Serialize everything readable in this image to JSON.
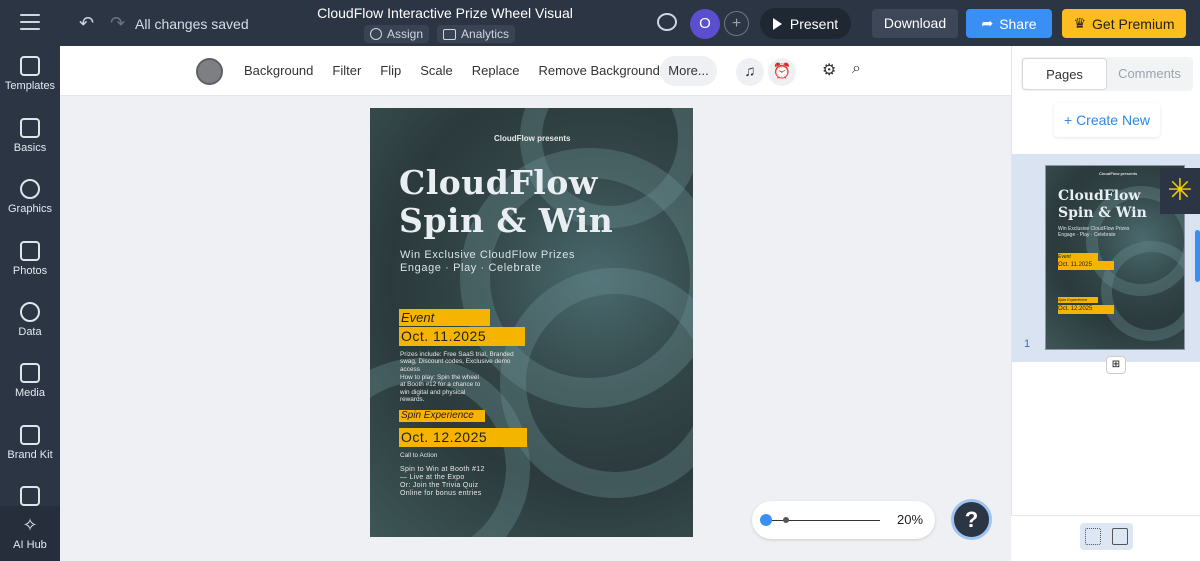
{
  "header": {
    "saved_status": "All changes saved",
    "title": "CloudFlow Interactive Prize Wheel Visual",
    "assign_label": "Assign",
    "analytics_label": "Analytics",
    "avatar_initial": "O",
    "present_label": "Present",
    "download_label": "Download",
    "share_label": "Share",
    "premium_label": "Get Premium"
  },
  "sidebar": {
    "items": [
      {
        "label": "Templates"
      },
      {
        "label": "Basics"
      },
      {
        "label": "Graphics"
      },
      {
        "label": "Photos"
      },
      {
        "label": "Data"
      },
      {
        "label": "Media"
      },
      {
        "label": "Brand Kit"
      },
      {
        "label": ""
      },
      {
        "label": "AI Hub"
      }
    ]
  },
  "toolbar": {
    "items": [
      "Background",
      "Filter",
      "Flip",
      "Scale",
      "Replace",
      "Remove Background"
    ],
    "more_label": "More..."
  },
  "poster": {
    "presents": "CloudFlow presents",
    "title_line1": "CloudFlow",
    "title_line2": "Spin & Win",
    "sub_line1": "Win Exclusive CloudFlow Prizes",
    "sub_line2": "Engage · Play · Celebrate",
    "event_label": "Event",
    "event_date": "Oct. 11.2025",
    "prizes_text": "Prizes include: Free SaaS trial, Branded swag, Discount codes, Exclusive demo access",
    "howto_text": "How to play: Spin the wheel at Booth #12 for a chance to win digital and physical rewards.",
    "spin_label": "Spin Experience",
    "spin_date": "Oct. 12.2025",
    "cta_label": "Call to Action",
    "cta_text1": "Spin to Win at Booth #12",
    "cta_text2": "— Live at the Expo",
    "cta_text3": "Or: Join the Trivia Quiz",
    "cta_text4": "Online for bonus entries"
  },
  "zoom": {
    "value": "20%",
    "level_fraction": 0.2
  },
  "help_label": "?",
  "right_panel": {
    "tab_pages": "Pages",
    "tab_comments": "Comments",
    "create_new": "+ Create New",
    "page_number": "1"
  },
  "colors": {
    "dark": "#2c3544",
    "accent_blue": "#3a8ff5",
    "premium_yellow": "#fbbd1f",
    "poster_yellow": "#f5b400"
  }
}
